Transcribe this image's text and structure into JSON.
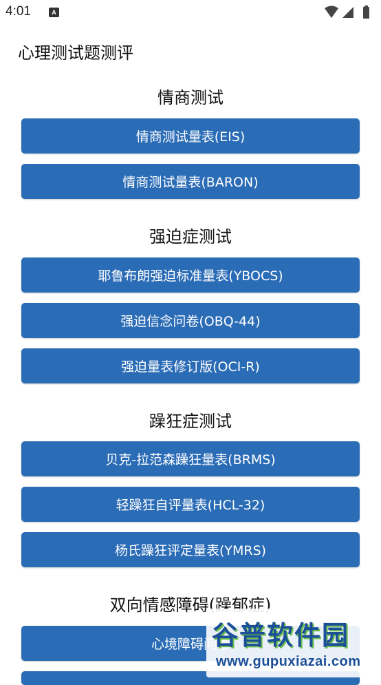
{
  "status_bar": {
    "time": "4:01",
    "app_icon": "A"
  },
  "app": {
    "title": "心理测试题测评"
  },
  "sections": [
    {
      "title": "情商测试",
      "buttons": [
        "情商测试量表(EIS)",
        "情商测试量表(BARON)"
      ]
    },
    {
      "title": "强迫症测试",
      "buttons": [
        "耶鲁布朗强迫标准量表(YBOCS)",
        "强迫信念问卷(OBQ-44)",
        "强迫量表修订版(OCI-R)"
      ]
    },
    {
      "title": "躁狂症测试",
      "buttons": [
        "贝克-拉范森躁狂量表(BRMS)",
        "轻躁狂自评量表(HCL-32)",
        "杨氏躁狂评定量表(YMRS)"
      ]
    },
    {
      "title": "双向情感障碍(躁郁症)",
      "buttons": [
        "心境障碍问卷"
      ]
    }
  ],
  "watermark": {
    "logo_text": "谷普软件园",
    "url": "www.gupuxiazai.com"
  },
  "colors": {
    "button_bg": "#2B6CB6",
    "button_text": "#FFFFFF",
    "watermark_blue": "#1D4F99",
    "watermark_green": "#6CC04A"
  }
}
